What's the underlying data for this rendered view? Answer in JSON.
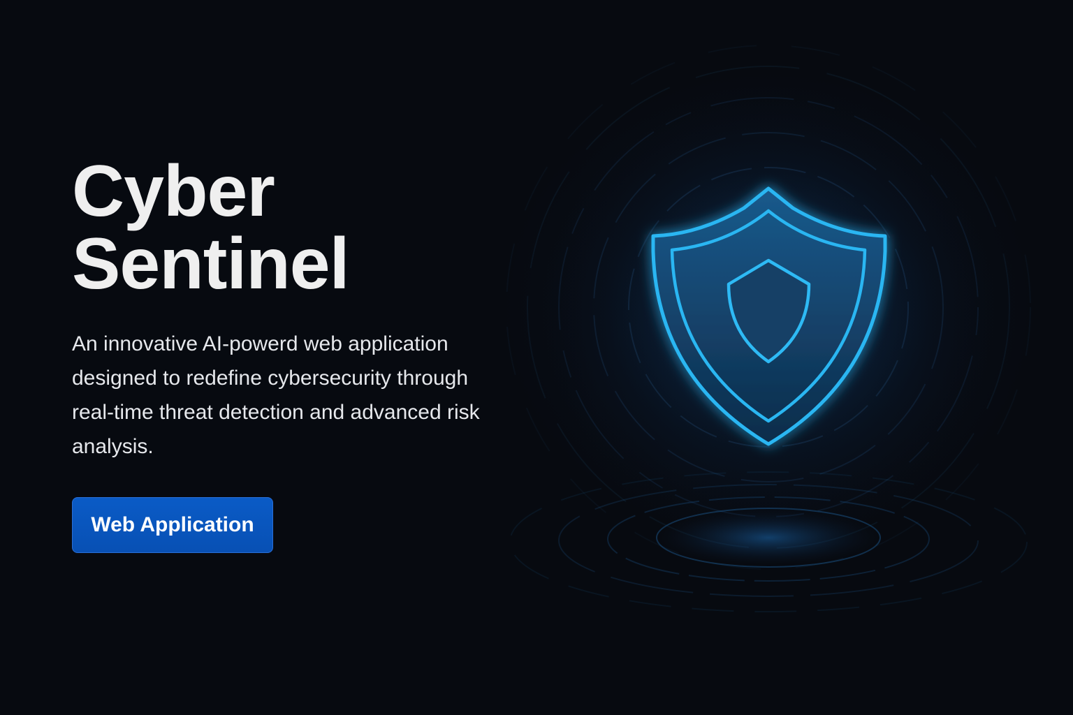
{
  "hero": {
    "title_line1": "Cyber",
    "title_line2": "Sentinel",
    "description": "An innovative AI-powerd web application designed to redefine cybersecurity through real-time threat detection and advanced risk analysis.",
    "button_label": "Web Application"
  },
  "emblem": {
    "icon": "shield-icon",
    "accent_color": "#29b6f2"
  },
  "colors": {
    "background": "#070a10",
    "button": "#0a57c2",
    "text": "#efefef"
  }
}
